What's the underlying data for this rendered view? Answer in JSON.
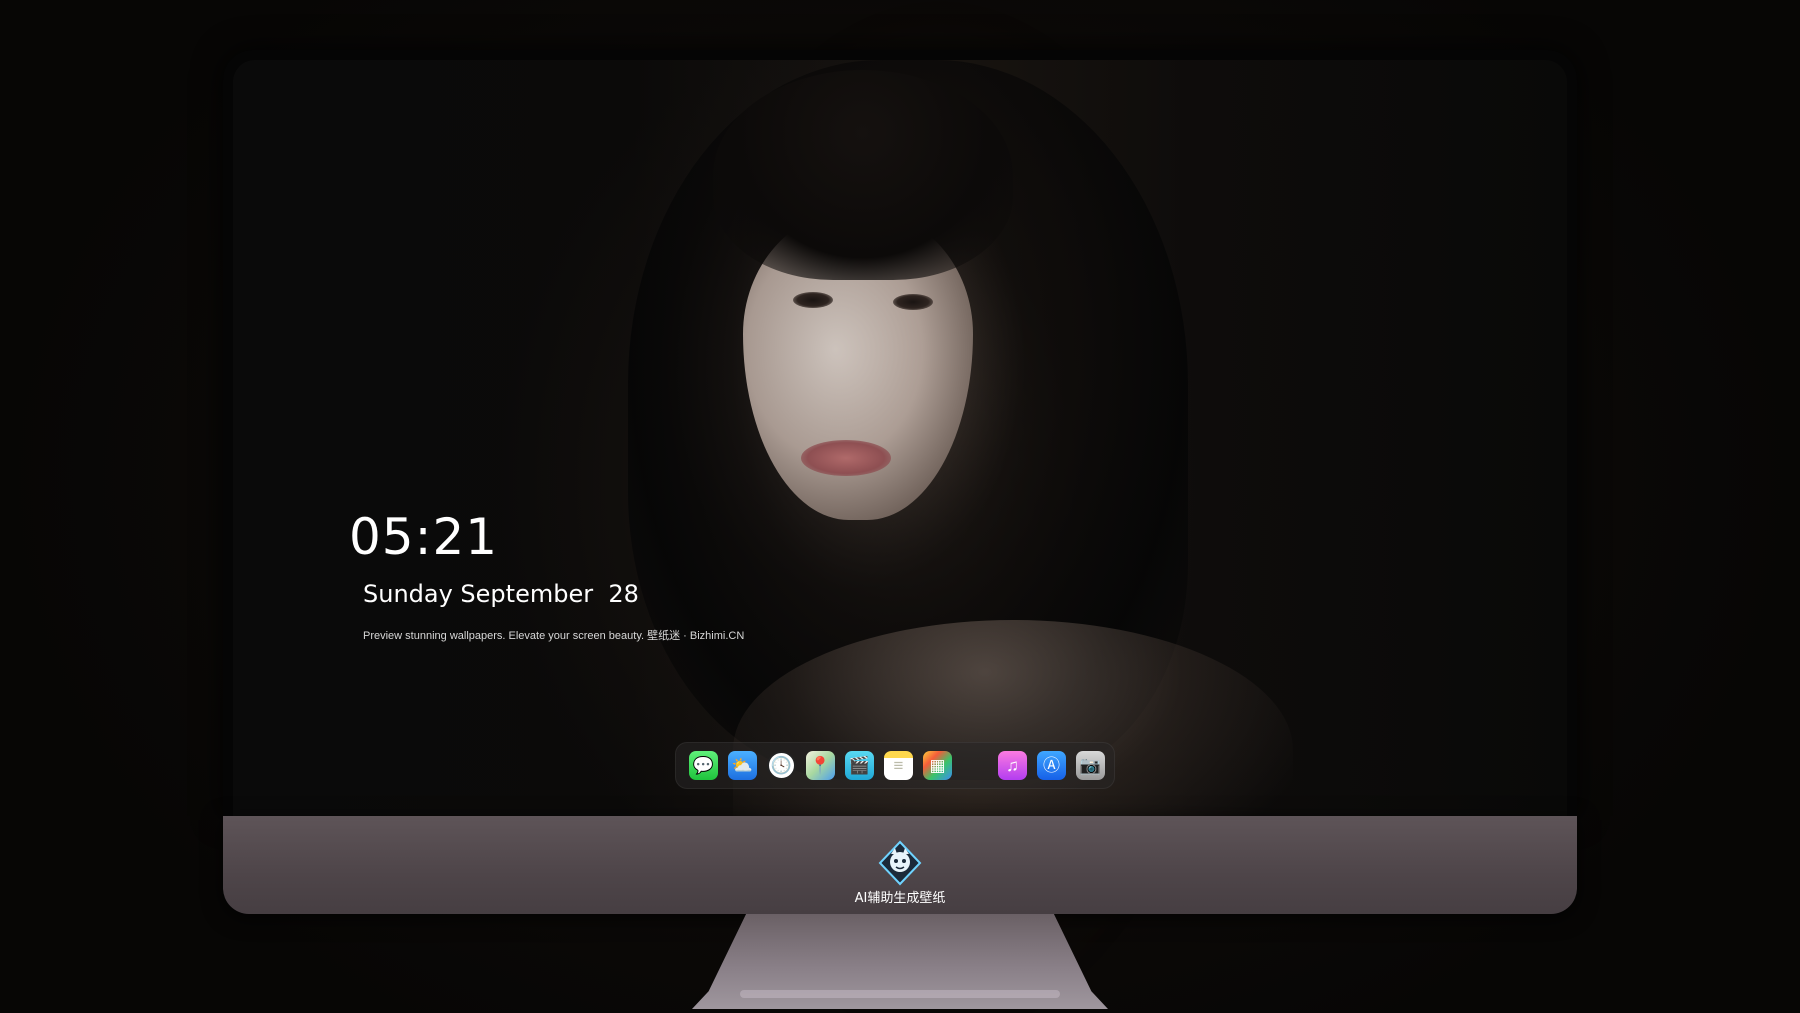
{
  "lockscreen": {
    "time": "05:21",
    "date": "Sunday September  28",
    "tagline": "Preview stunning wallpapers. Elevate your screen beauty. 壁纸迷 · Bizhimi.CN"
  },
  "dock": {
    "apps": [
      {
        "name": "messages",
        "icon": "speech-bubble-icon",
        "glyph": "💬"
      },
      {
        "name": "weather",
        "icon": "cloud-sun-icon",
        "glyph": "⛅"
      },
      {
        "name": "clock",
        "icon": "clock-icon",
        "glyph": "🕓"
      },
      {
        "name": "maps",
        "icon": "map-icon",
        "glyph": "📍"
      },
      {
        "name": "clips",
        "icon": "clapperboard-icon",
        "glyph": "🎬"
      },
      {
        "name": "notes",
        "icon": "notes-icon",
        "glyph": "≡"
      },
      {
        "name": "photos",
        "icon": "photos-icon",
        "glyph": "▦"
      },
      {
        "name": "music",
        "icon": "music-note-icon",
        "glyph": "♫"
      },
      {
        "name": "app-store",
        "icon": "app-store-icon",
        "glyph": "Ⓐ"
      },
      {
        "name": "camera",
        "icon": "camera-icon",
        "glyph": "📷"
      }
    ]
  },
  "chin": {
    "logo_icon": "mascot-logo-icon",
    "label": "AI辅助生成壁纸"
  },
  "colors": {
    "chin": "#4e4549",
    "stand": "#8a8088",
    "background": "#0b0907"
  }
}
